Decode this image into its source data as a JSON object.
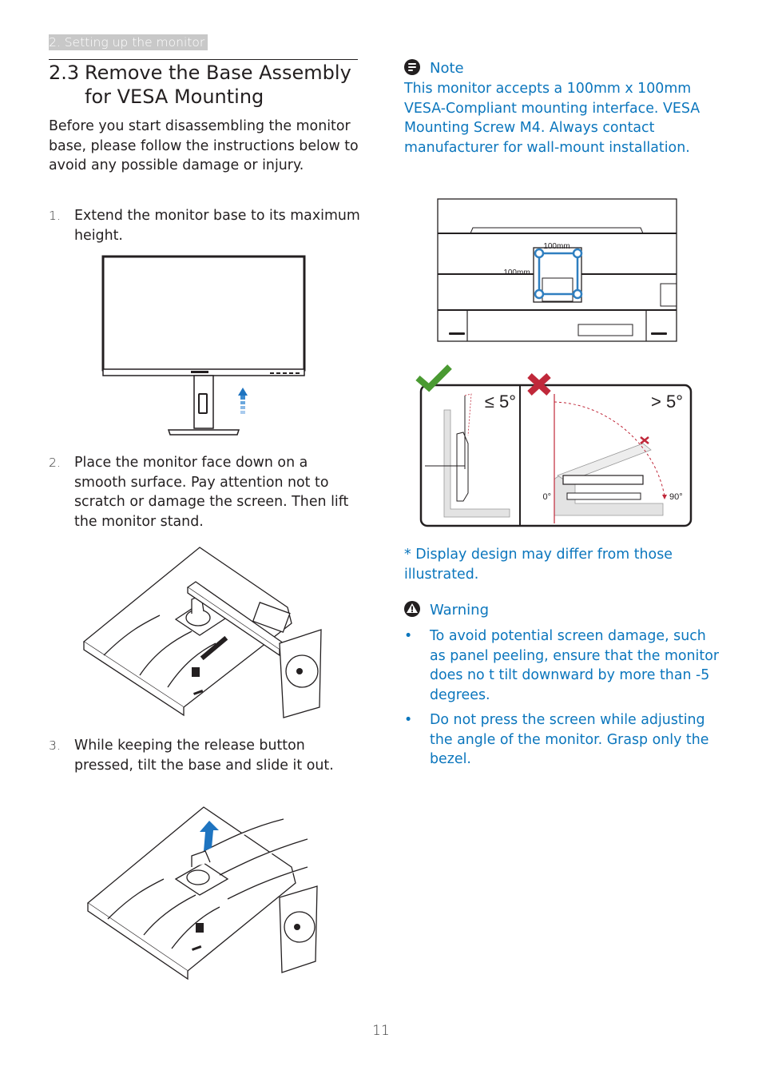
{
  "header": {
    "section_tab": "2. Setting up the monitor",
    "section_number": "2.3",
    "section_title": "Remove the Base Assembly for VESA Mounting"
  },
  "intro": "Before you start disassembling the monitor base, please follow the instructions below to avoid any possible damage or injury.",
  "steps": [
    {
      "number": "1.",
      "text": "Extend the monitor base to its maximum height."
    },
    {
      "number": "2.",
      "text": "Place the monitor face down on a smooth surface. Pay attention not to scratch or damage the screen. Then lift the monitor stand."
    },
    {
      "number": "3.",
      "text": "While keeping the release button pressed, tilt the base and slide it out."
    }
  ],
  "note": {
    "icon": "note-icon",
    "heading": "Note",
    "body": "This monitor accepts a 100mm x 100mm VESA-Compliant mounting interface. VESA Mounting Screw M4. Always contact manufacturer for wall-mount installation."
  },
  "vesa_diagram": {
    "width_label": "100mm",
    "height_label": "100mm"
  },
  "tilt_diagram": {
    "ok_label": "≤ 5°",
    "bad_label": "> 5°",
    "angle_start": "0°",
    "angle_end": "90°",
    "ok_icon": "checkmark-icon",
    "bad_icon": "cross-icon"
  },
  "disclaimer": "* Display design may differ from those illustrated.",
  "warning": {
    "icon": "warning-icon",
    "heading": "Warning",
    "bullets": [
      "To avoid potential screen damage, such as panel peeling, ensure that the monitor does no t tilt downward by more than -5 degrees.",
      "Do not press the screen while adjusting the angle of the monitor. Grasp only the bezel."
    ]
  },
  "footer": {
    "page_number": "11"
  },
  "colors": {
    "accent_blue": "#0b76bd",
    "ok_green": "#4a9a32",
    "bad_red": "#c0283a",
    "vesa_blue": "#2f7fc0"
  }
}
